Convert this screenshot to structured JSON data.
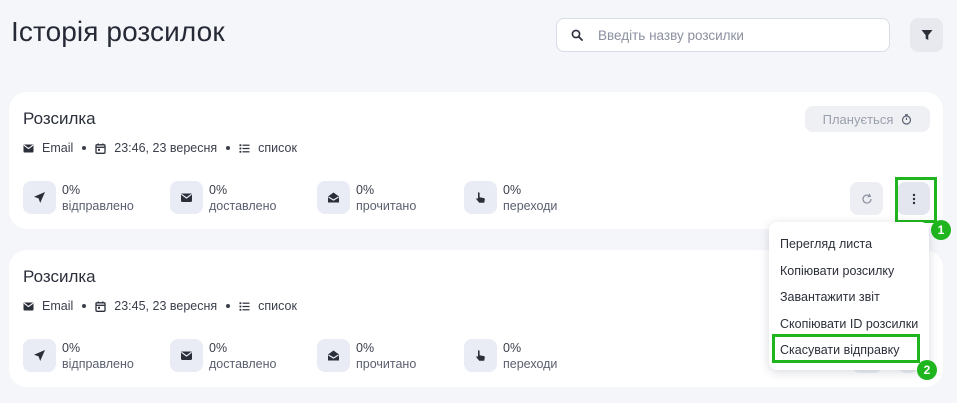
{
  "page": {
    "title": "Історія розсилок"
  },
  "search": {
    "placeholder": "Введіть назву розсилки",
    "icon": "search-icon"
  },
  "filter": {
    "icon": "filter-icon"
  },
  "campaigns": [
    {
      "title": "Розсилка",
      "channel": "Email",
      "datetime": "23:46, 23 вересня",
      "list": "список",
      "status": "Планується",
      "stats": [
        {
          "value": "0%",
          "label": "відправлено",
          "icon": "send-icon"
        },
        {
          "value": "0%",
          "label": "доставлено",
          "icon": "mail-icon"
        },
        {
          "value": "0%",
          "label": "прочитано",
          "icon": "open-mail-icon"
        },
        {
          "value": "0%",
          "label": "переходи",
          "icon": "pointer-icon"
        }
      ]
    },
    {
      "title": "Розсилка",
      "channel": "Email",
      "datetime": "23:45, 23 вересня",
      "list": "список",
      "stats": [
        {
          "value": "0%",
          "label": "відправлено",
          "icon": "send-icon"
        },
        {
          "value": "0%",
          "label": "доставлено",
          "icon": "mail-icon"
        },
        {
          "value": "0%",
          "label": "прочитано",
          "icon": "open-mail-icon"
        },
        {
          "value": "0%",
          "label": "переходи",
          "icon": "pointer-icon"
        }
      ]
    }
  ],
  "menu": {
    "items": [
      "Перегляд листа",
      "Копіювати розсилку",
      "Завантажити звіт",
      "Скопіювати ID розсилки",
      "Скасувати відправку"
    ]
  },
  "annotations": {
    "step1": "1",
    "step2": "2",
    "highlight_color": "#1fb51f"
  },
  "colors": {
    "background": "#f5f6fa",
    "card": "#ffffff",
    "icon_bg": "#e9ecf5"
  }
}
